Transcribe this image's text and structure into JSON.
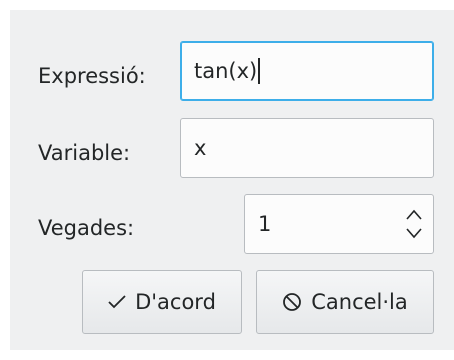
{
  "form": {
    "expression_label": "Expressió:",
    "expression_value": "tan(x)",
    "variable_label": "Variable:",
    "variable_value": "x",
    "times_label": "Vegades:",
    "times_value": "1"
  },
  "buttons": {
    "ok_label": "D'acord",
    "cancel_label": "Cancel·la"
  },
  "icons": {
    "ok": "check-icon",
    "cancel": "cancel-circle-icon",
    "spin": "spin-up-down-icon"
  },
  "colors": {
    "background": "#eff0f1",
    "focus_border": "#3daee9",
    "text": "#232627"
  }
}
